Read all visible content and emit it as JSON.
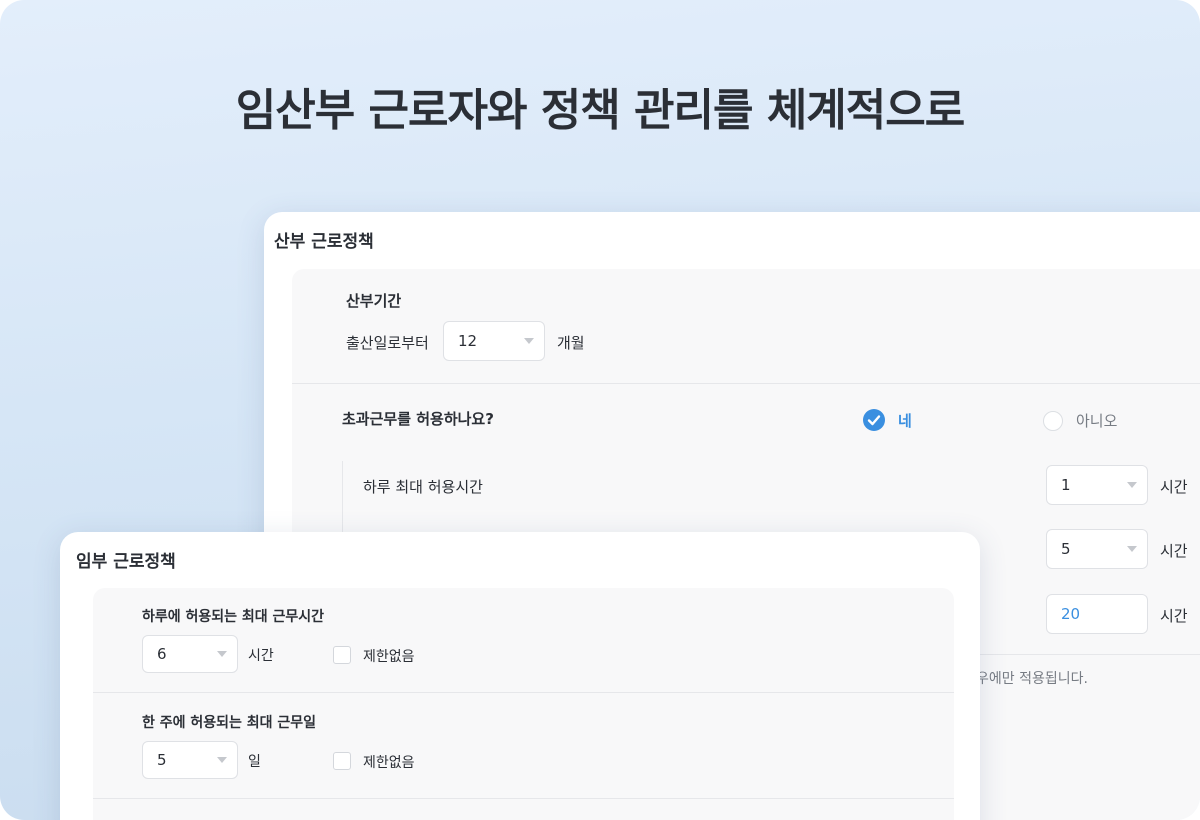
{
  "headline": "임산부 근로자와 정책 관리를 체계적으로",
  "childbirth_policy": {
    "title": "산부 근로정책",
    "period_section": {
      "title": "산부기간",
      "from_label": "출산일로부터",
      "months_value": "12",
      "months_unit": "개월"
    },
    "overtime_section": {
      "question": "초과근무를 허용하나요?",
      "option_yes": "네",
      "option_no": "아니오",
      "rows": [
        {
          "label": "하루 최대 허용시간",
          "value": "1",
          "unit": "시간"
        },
        {
          "label": "",
          "value": "5",
          "unit": "시간"
        },
        {
          "label": "",
          "value": "20",
          "unit": "시간"
        }
      ],
      "note_fragment": "우에만 적용됩니다."
    }
  },
  "pregnancy_policy": {
    "title": "임부 근로정책",
    "daily_hours": {
      "title": "하루에 허용되는 최대 근무시간",
      "value": "6",
      "unit": "시간",
      "unlimited_label": "제한없음"
    },
    "weekly_days": {
      "title": "한 주에 허용되는 최대 근무일",
      "value": "5",
      "unit": "일",
      "unlimited_label": "제한없음"
    }
  },
  "colors": {
    "accent": "#3a8fe0",
    "text": "#2b2f36",
    "background_top": "#e3eefb",
    "background_bottom": "#c9dcef"
  },
  "icons": {
    "radio_selected": "check-circle-icon",
    "select_caret": "caret-down-icon"
  }
}
